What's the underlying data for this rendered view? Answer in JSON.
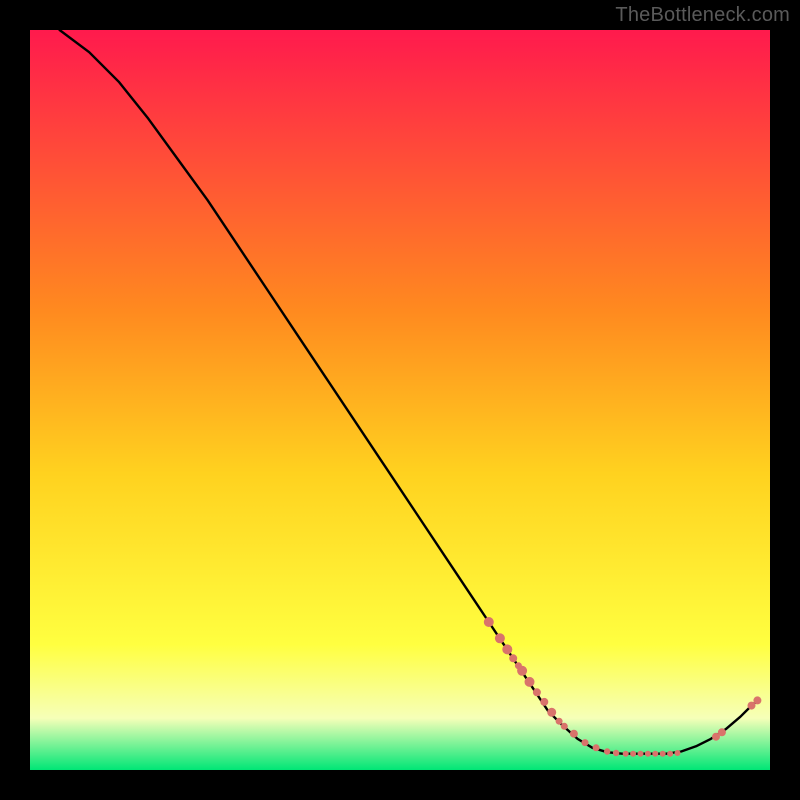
{
  "watermark": "TheBottleneck.com",
  "colors": {
    "gradient_top": "#ff1a4d",
    "gradient_mid_upper": "#ff8a1f",
    "gradient_mid": "#ffd21f",
    "gradient_mid_lower": "#ffff40",
    "gradient_lower": "#f6ffb8",
    "gradient_bottom": "#00e676",
    "background": "#000000",
    "curve": "#000000",
    "markers": "#d9736b"
  },
  "chart_data": {
    "type": "line",
    "title": "",
    "xlabel": "",
    "ylabel": "",
    "xlim": [
      0,
      100
    ],
    "ylim": [
      0,
      100
    ],
    "curve": [
      {
        "x": 4,
        "y": 100
      },
      {
        "x": 8,
        "y": 97
      },
      {
        "x": 12,
        "y": 93
      },
      {
        "x": 16,
        "y": 88
      },
      {
        "x": 20,
        "y": 82.5
      },
      {
        "x": 24,
        "y": 77
      },
      {
        "x": 28,
        "y": 71
      },
      {
        "x": 32,
        "y": 65
      },
      {
        "x": 36,
        "y": 59
      },
      {
        "x": 40,
        "y": 53
      },
      {
        "x": 44,
        "y": 47
      },
      {
        "x": 48,
        "y": 41
      },
      {
        "x": 52,
        "y": 35
      },
      {
        "x": 56,
        "y": 29
      },
      {
        "x": 60,
        "y": 23
      },
      {
        "x": 62,
        "y": 20
      },
      {
        "x": 64,
        "y": 17
      },
      {
        "x": 66,
        "y": 14
      },
      {
        "x": 68,
        "y": 11
      },
      {
        "x": 70,
        "y": 8
      },
      {
        "x": 72,
        "y": 6
      },
      {
        "x": 74,
        "y": 4.2
      },
      {
        "x": 76,
        "y": 3.0
      },
      {
        "x": 78,
        "y": 2.4
      },
      {
        "x": 80,
        "y": 2.2
      },
      {
        "x": 82,
        "y": 2.2
      },
      {
        "x": 84,
        "y": 2.2
      },
      {
        "x": 86,
        "y": 2.2
      },
      {
        "x": 88,
        "y": 2.5
      },
      {
        "x": 90,
        "y": 3.2
      },
      {
        "x": 92,
        "y": 4.2
      },
      {
        "x": 94,
        "y": 5.5
      },
      {
        "x": 96,
        "y": 7.2
      },
      {
        "x": 97.5,
        "y": 8.7
      },
      {
        "x": 98.5,
        "y": 9.5
      }
    ],
    "markers": [
      {
        "x": 62.0,
        "y": 20.0,
        "r": 5.0
      },
      {
        "x": 63.5,
        "y": 17.8,
        "r": 5.0
      },
      {
        "x": 64.5,
        "y": 16.3,
        "r": 5.0
      },
      {
        "x": 65.3,
        "y": 15.1,
        "r": 4.0
      },
      {
        "x": 66.5,
        "y": 13.4,
        "r": 5.0
      },
      {
        "x": 67.5,
        "y": 11.9,
        "r": 5.0
      },
      {
        "x": 68.5,
        "y": 10.5,
        "r": 4.0
      },
      {
        "x": 66.0,
        "y": 14.1,
        "r": 3.5
      },
      {
        "x": 69.5,
        "y": 9.2,
        "r": 4.0
      },
      {
        "x": 70.5,
        "y": 7.8,
        "r": 4.5
      },
      {
        "x": 71.5,
        "y": 6.6,
        "r": 3.5
      },
      {
        "x": 73.5,
        "y": 4.9,
        "r": 4.0
      },
      {
        "x": 72.2,
        "y": 5.9,
        "r": 3.5
      },
      {
        "x": 75.0,
        "y": 3.7,
        "r": 3.5
      },
      {
        "x": 76.5,
        "y": 3.0,
        "r": 3.5
      },
      {
        "x": 78.0,
        "y": 2.5,
        "r": 3.2
      },
      {
        "x": 79.2,
        "y": 2.3,
        "r": 3.2
      },
      {
        "x": 80.5,
        "y": 2.2,
        "r": 3.0
      },
      {
        "x": 81.5,
        "y": 2.2,
        "r": 3.0
      },
      {
        "x": 82.5,
        "y": 2.2,
        "r": 3.0
      },
      {
        "x": 83.5,
        "y": 2.2,
        "r": 3.0
      },
      {
        "x": 84.5,
        "y": 2.2,
        "r": 3.0
      },
      {
        "x": 85.5,
        "y": 2.2,
        "r": 3.0
      },
      {
        "x": 86.5,
        "y": 2.2,
        "r": 3.0
      },
      {
        "x": 87.5,
        "y": 2.3,
        "r": 3.0
      },
      {
        "x": 92.7,
        "y": 4.5,
        "r": 4.0
      },
      {
        "x": 93.5,
        "y": 5.1,
        "r": 4.0
      },
      {
        "x": 97.5,
        "y": 8.7,
        "r": 4.0
      },
      {
        "x": 98.3,
        "y": 9.4,
        "r": 4.0
      }
    ]
  }
}
